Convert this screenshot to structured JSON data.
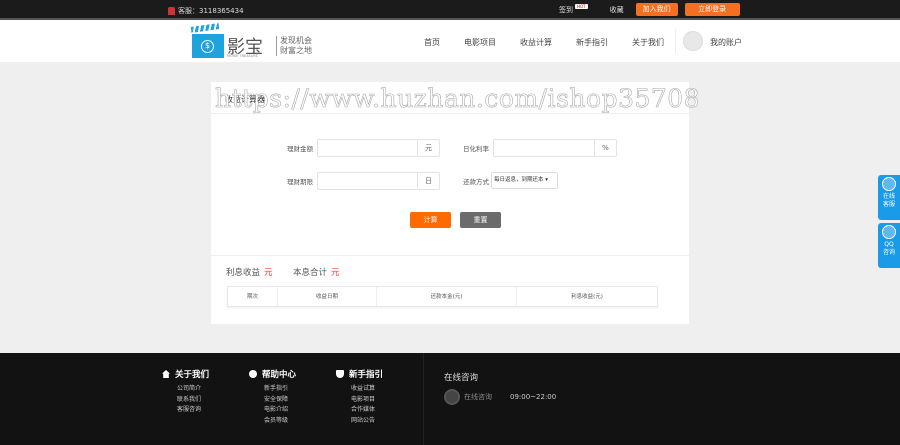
{
  "topbar": {
    "service": "客服：3118365434",
    "checkin": "签到",
    "hot": "HOT",
    "favorite": "收藏",
    "join": "加入我们",
    "login": "立即登录"
  },
  "header": {
    "logo_name": "影宝",
    "logo_en": "MOVIE TREASURE",
    "slogan1": "发现机会",
    "slogan2": "财富之地",
    "nav": [
      "首页",
      "电影项目",
      "收益计算",
      "新手指引",
      "关于我们"
    ],
    "account": "我的账户"
  },
  "watermark": "https://www.huzhan.com/ishop35708",
  "calc": {
    "title": "收益计算器",
    "amount_label": "理财金额",
    "amount_value": "",
    "amount_unit": "元",
    "rate_label": "日化利率",
    "rate_value": "",
    "rate_unit": "%",
    "term_label": "理财期限",
    "term_value": "",
    "term_unit": "日",
    "method_label": "还款方式",
    "method_value": "每日返息，到期还本 ▾",
    "calc_btn": "计算",
    "reset_btn": "重置"
  },
  "result": {
    "interest_label": "利息收益",
    "interest_unit": "元",
    "total_label": "本息合计",
    "total_unit": "元",
    "columns": [
      "期次",
      "收益日期",
      "还款本金(元)",
      "利息收益(元)"
    ]
  },
  "footer": {
    "cols": [
      {
        "title": "关于我们",
        "items": [
          "公司简介",
          "联系我们",
          "客服咨询"
        ]
      },
      {
        "title": "帮助中心",
        "items": [
          "新手指引",
          "安全保障",
          "电影介绍",
          "会员等级"
        ]
      },
      {
        "title": "新手指引",
        "items": [
          "收益试算",
          "电影项目",
          "合作媒体",
          "网站公告"
        ]
      }
    ],
    "online_title": "在线咨询",
    "online_label": "在线咨询",
    "hours": "09:00~22:00"
  },
  "side": {
    "service": "在线客服",
    "qq": "QQ咨询"
  }
}
